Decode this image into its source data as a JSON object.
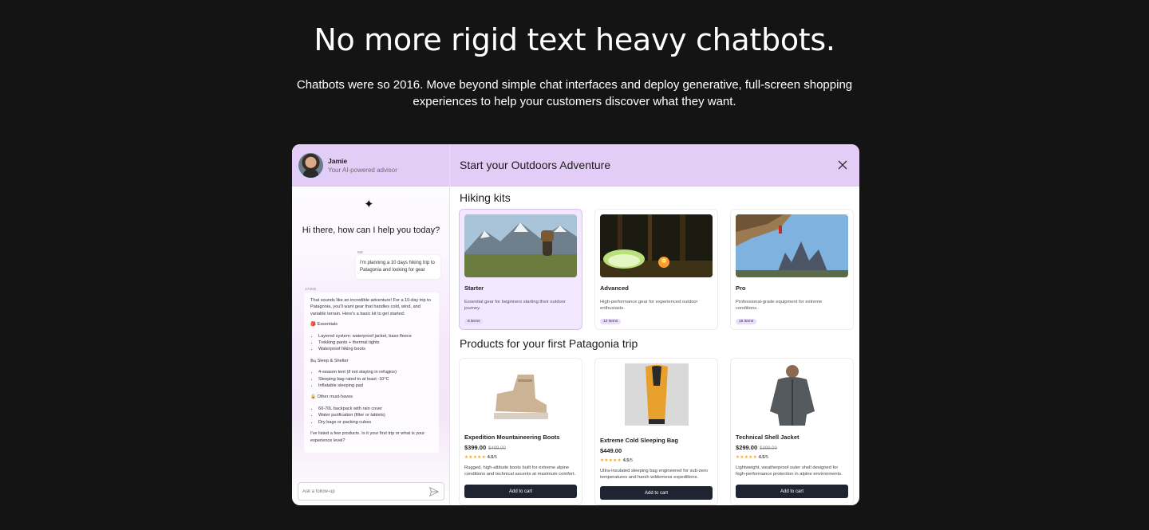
{
  "hero": {
    "title": "No more rigid text heavy chatbots.",
    "subtitle": "Chatbots were so 2016. Move beyond simple chat interfaces and deploy generative, full-screen shopping experiences to help your customers discover what they want."
  },
  "chat": {
    "advisor_name": "Jamie",
    "advisor_role": "Your AI-powered advisor",
    "sparkle_icon": "✦",
    "greeting": "Hi there, how can I help you today?",
    "me_label": "ME",
    "user_message": "I'm planning a 10 days hiking trip to Patagonia and looking for gear",
    "jamie_label": "JAMIE",
    "reply_intro": "That sounds like an incredible adventure! For a 10-day trip to Patagonia, you'll want gear that handles cold, wind, and variable terrain. Here's a basic kit to get started:",
    "sections": [
      {
        "title": "🎒 Essentials",
        "items": [
          "Layered system: waterproof jacket, base fleece",
          "Trekking pants + thermal tights",
          "Waterproof hiking boots"
        ]
      },
      {
        "title": "🛏 Sleep & Shelter",
        "items": [
          "4-season tent (if not staying in refugios)",
          "Sleeping bag rated to at least -10°C",
          "Inflatable sleeping pad"
        ]
      },
      {
        "title": "🔒 Other must-haves",
        "items": [
          "60-70L backpack with rain cover",
          "Water purification (filter or tablets)",
          "Dry bags or packing cubes"
        ]
      }
    ],
    "reply_outro": "I've listed a few products. Is it your first trip or what is your experience level?",
    "input_placeholder": "Ask a follow-up"
  },
  "main": {
    "title": "Start your Outdoors Adventure",
    "kits_heading": "Hiking kits",
    "kits": [
      {
        "name": "Starter",
        "desc": "Essential gear for beginners starting their outdoor journey.",
        "badge": "8 items"
      },
      {
        "name": "Advanced",
        "desc": "High-performance gear for experienced outdoor enthusiasts.",
        "badge": "12 items"
      },
      {
        "name": "Pro",
        "desc": "Professional-grade equipment for extreme conditions.",
        "badge": "15 items"
      }
    ],
    "products_heading": "Products for your first Patagonia trip",
    "products": [
      {
        "name": "Expedition Mountaineering Boots",
        "price": "$399.00",
        "old_price": "$499.00",
        "stars": "★★★★★",
        "rating": "4.5",
        "rating_max": "/5",
        "desc": "Rugged, high-altitude boots built for extreme alpine conditions and technical ascents at maximum comfort.",
        "cta": "Add to cart"
      },
      {
        "name": "Extreme Cold Sleeping Bag",
        "price": "$449.00",
        "old_price": "",
        "stars": "★★★★★",
        "rating": "4.5",
        "rating_max": "/5",
        "desc": "Ultra-insulated sleeping bag engineered for sub-zero temperatures and harsh wilderness expeditions.",
        "cta": "Add to cart"
      },
      {
        "name": "Technical Shell Jacket",
        "price": "$299.00",
        "old_price": "$399.00",
        "stars": "★★★★★",
        "rating": "4.5",
        "rating_max": "/5",
        "desc": "Lightweight, weatherproof outer shell designed for high-performance protection in alpine environments.",
        "cta": "Add to cart"
      }
    ]
  },
  "colors": {
    "header_lilac": "#e2cdf6",
    "button_dark": "#1f2530",
    "page_bg": "#141414"
  }
}
